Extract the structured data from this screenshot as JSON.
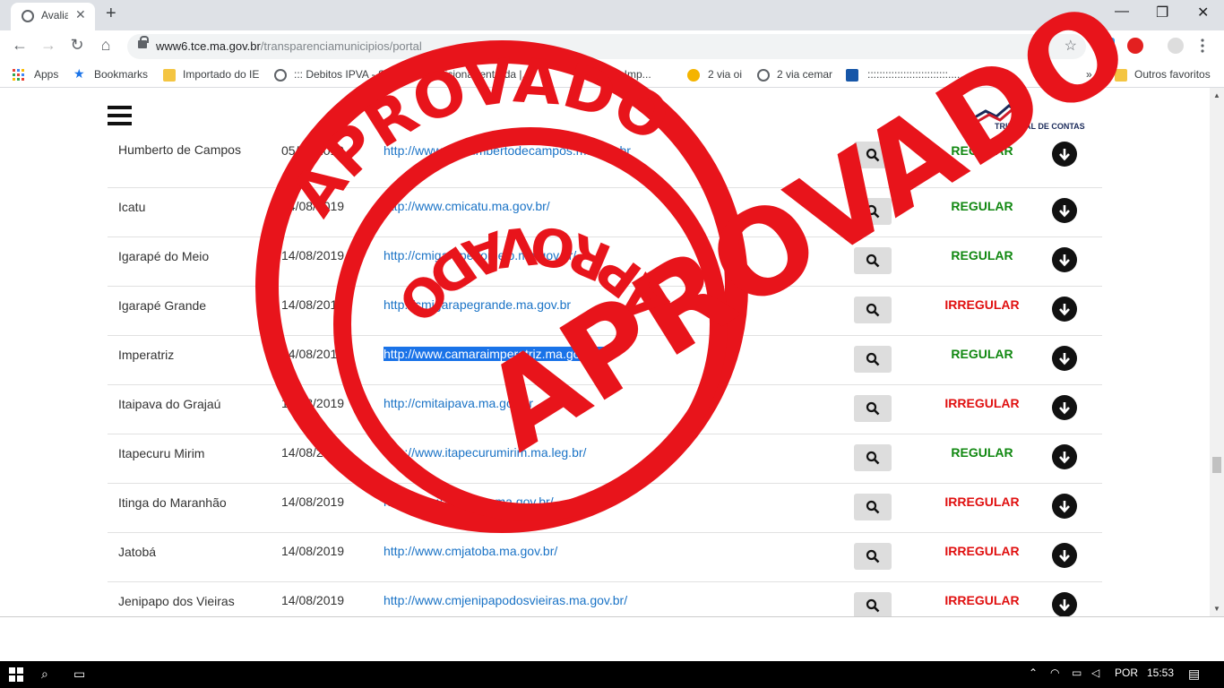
{
  "browser": {
    "tab_title": "Avalia",
    "tab_close": "✕",
    "new_tab": "+",
    "url_domain": "www6.tce.ma.gov.br",
    "url_path": "/transparenciamunicipios/portal"
  },
  "bookmarks": [
    {
      "label": "Apps"
    },
    {
      "label": "Bookmarks"
    },
    {
      "label": "Importado do IE"
    },
    {
      "label": "::: Debitos IPVA - SE"
    },
    {
      "label": "Adicionar entrada |..."
    },
    {
      "label": "C...ADOR Imp..."
    },
    {
      "label": "2 via oi"
    },
    {
      "label": "2 via cemar"
    },
    {
      "label": ":::::::::::::::::::::::::::.......... h..."
    }
  ],
  "bookmarks_overflow": "»",
  "other_favorites": "Outros favoritos",
  "logo_text": "TRIBUNAL DE CONTAS",
  "rows": [
    {
      "name": "Humberto de Campos",
      "date": "05/08/2019",
      "link": "http://www.cmhumbertodecampos.ma.gov.br",
      "status": "REGULAR",
      "kind": "regular"
    },
    {
      "name": "Icatu",
      "date": "14/08/2019",
      "link": "http://www.cmicatu.ma.gov.br/",
      "status": "REGULAR",
      "kind": "regular"
    },
    {
      "name": "Igarapé do Meio",
      "date": "14/08/2019",
      "link": "http://cmigarapedomeio.ma.gov.br/",
      "status": "REGULAR",
      "kind": "regular"
    },
    {
      "name": "Igarapé Grande",
      "date": "14/08/2019",
      "link": "http://cmigarapegrande.ma.gov.br",
      "status": "IRREGULAR",
      "kind": "irregular"
    },
    {
      "name": "Imperatriz",
      "date": "14/08/2019",
      "link": "http://www.camaraimperatriz.ma.gov.br/",
      "status": "REGULAR",
      "kind": "regular"
    },
    {
      "name": "Itaipava do Grajaú",
      "date": "14/08/2019",
      "link": "http://cmitaipava.ma.gov.br",
      "status": "IRREGULAR",
      "kind": "irregular"
    },
    {
      "name": "Itapecuru Mirim",
      "date": "14/08/2019",
      "link": "http://www.itapecurumirim.ma.leg.br/",
      "status": "REGULAR",
      "kind": "regular"
    },
    {
      "name": "Itinga do Maranhão",
      "date": "14/08/2019",
      "link": "http://www.cmitinga.ma.gov.br/",
      "status": "IRREGULAR",
      "kind": "irregular"
    },
    {
      "name": "Jatobá",
      "date": "14/08/2019",
      "link": "http://www.cmjatoba.ma.gov.br/",
      "status": "IRREGULAR",
      "kind": "irregular"
    },
    {
      "name": "Jenipapo dos Vieiras",
      "date": "14/08/2019",
      "link": "http://www.cmjenipapodosvieiras.ma.gov.br/",
      "status": "IRREGULAR",
      "kind": "irregular"
    }
  ],
  "stamp": {
    "word": "APROVADO",
    "color": "#e8141b"
  },
  "taskbar": {
    "lang": "POR",
    "time": "15:53"
  }
}
